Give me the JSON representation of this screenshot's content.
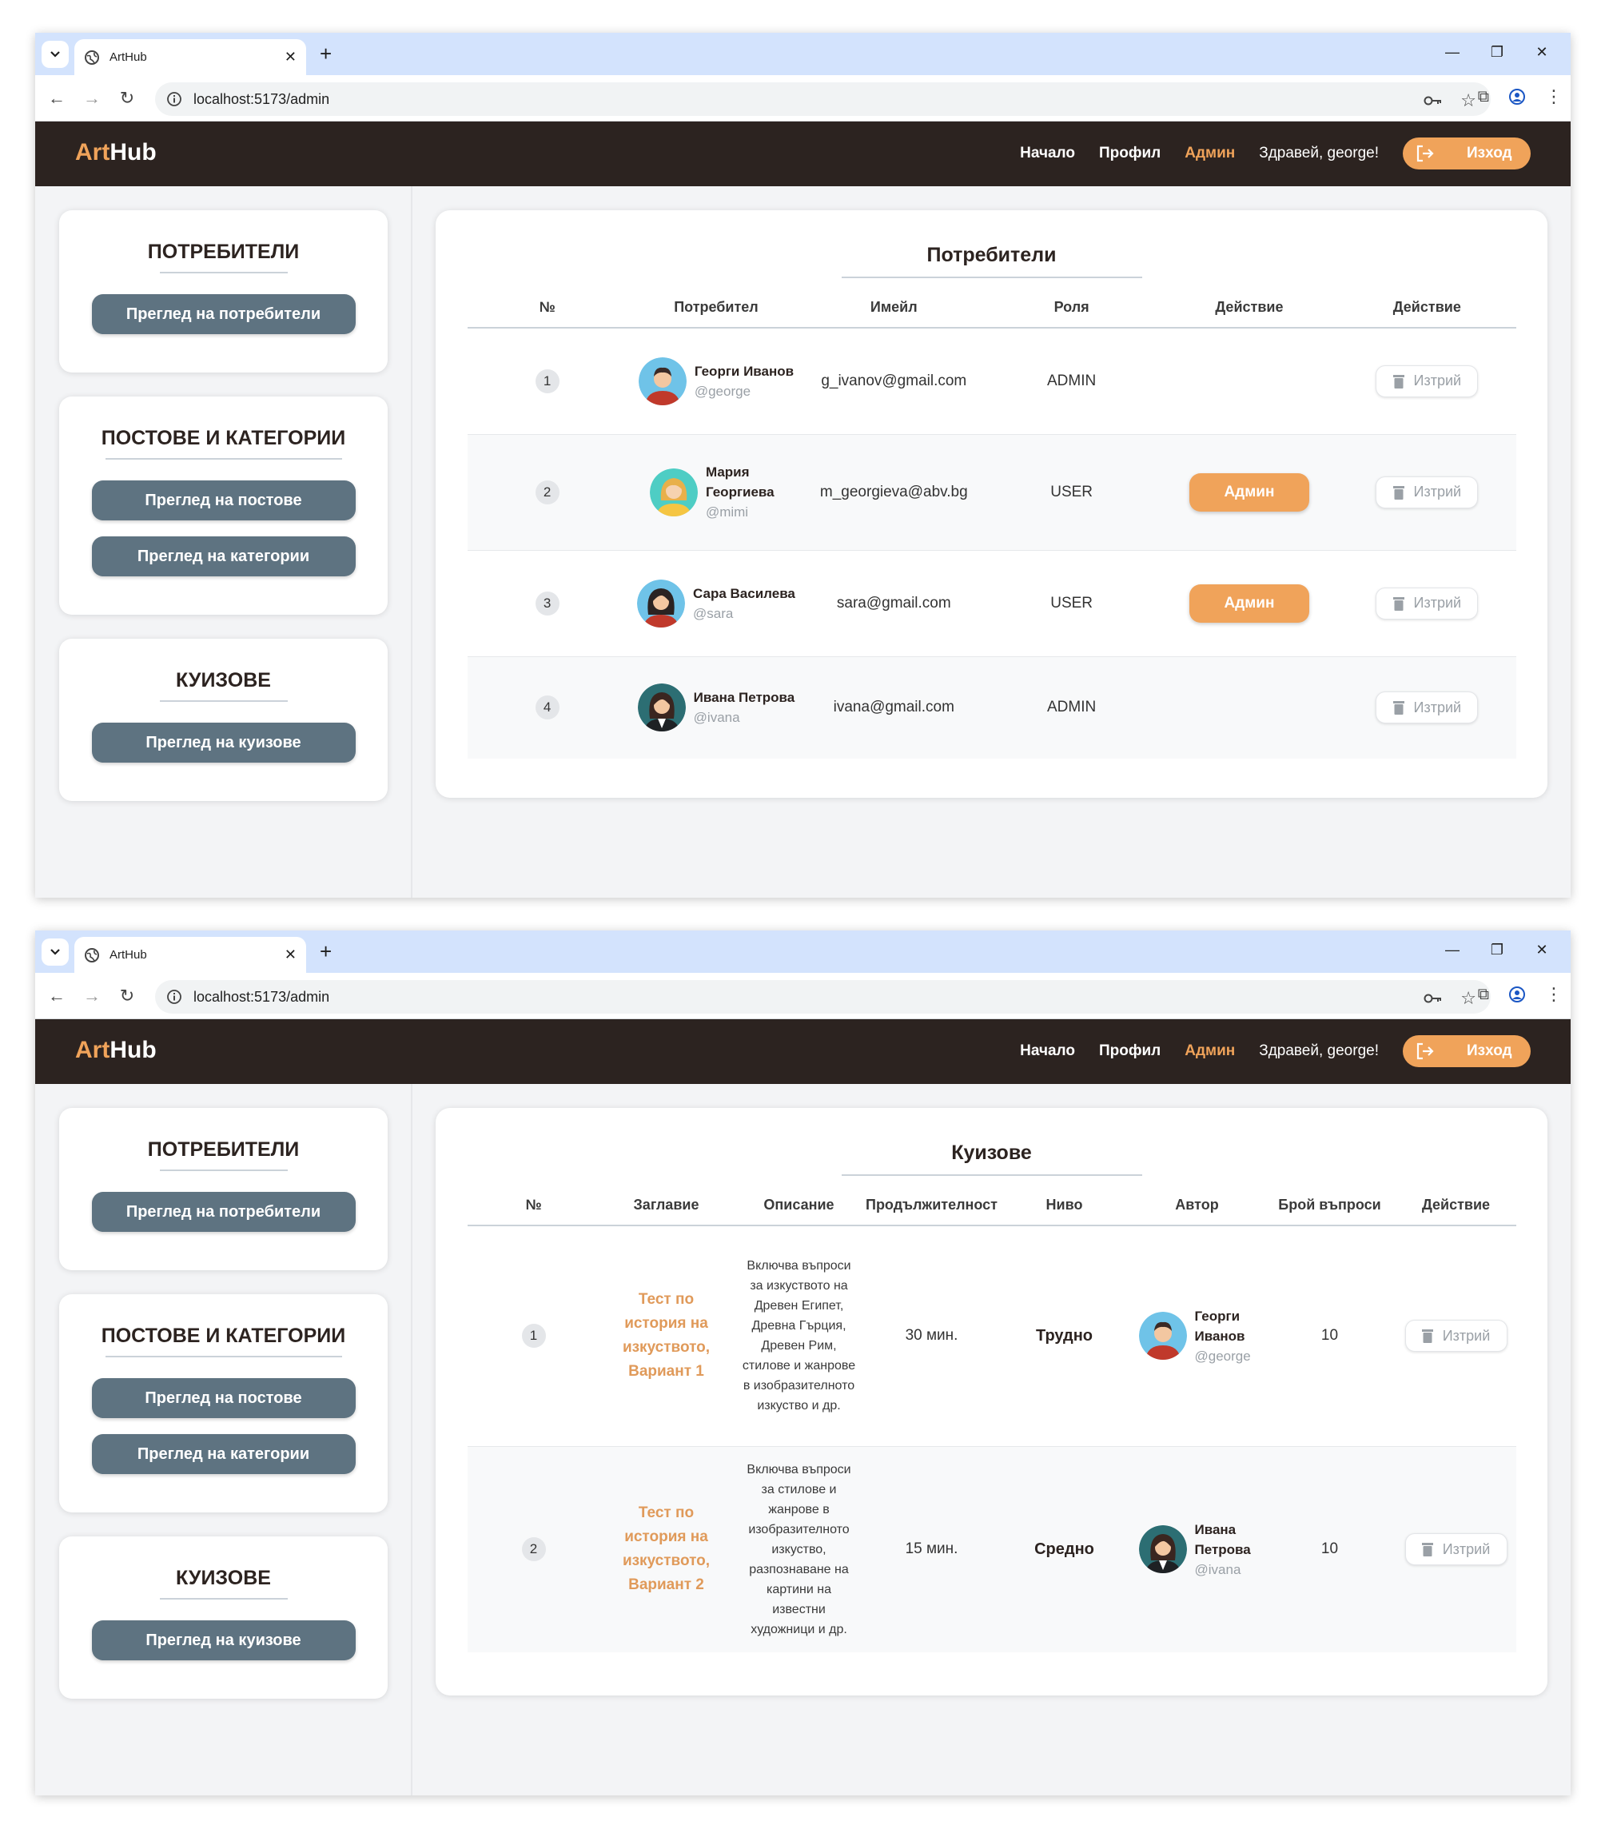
{
  "browser": {
    "tab_title": "ArtHub",
    "url": "localhost:5173/admin"
  },
  "header": {
    "logo_part1": "Art",
    "logo_part2": "Hub",
    "nav": [
      "Начало",
      "Профил",
      "Админ"
    ],
    "greeting": "Здравей, george!",
    "logout": "Изход",
    "accent_color": "#f0a35a",
    "bg_color": "#2c2320"
  },
  "sidebar": {
    "users_title": "ПОТРЕБИТЕЛИ",
    "users_btn": "Преглед на потребители",
    "posts_title": "ПОСТОВЕ И КАТЕГОРИИ",
    "posts_btn": "Преглед на постове",
    "categories_btn": "Преглед на категории",
    "quizzes_title": "КУИЗОВЕ",
    "quizzes_btn": "Преглед на куизове"
  },
  "users_view": {
    "title": "Потребители",
    "columns": [
      "№",
      "Потребител",
      "Имейл",
      "Роля",
      "Действие",
      "Действие"
    ],
    "rows": [
      {
        "n": "1",
        "name": "Георги Иванов",
        "handle": "@george",
        "email": "g_ivanov@gmail.com",
        "role": "ADMIN",
        "admin_btn": "",
        "delete": "Изтрий",
        "avatar": "man-avatar"
      },
      {
        "n": "2",
        "name": "Мария Георгиева",
        "handle": "@mimi",
        "email": "m_georgieva@abv.bg",
        "role": "USER",
        "admin_btn": "Админ",
        "delete": "Изтрий",
        "avatar": "woman-blonde-avatar"
      },
      {
        "n": "3",
        "name": "Сара Василева",
        "handle": "@sara",
        "email": "sara@gmail.com",
        "role": "USER",
        "admin_btn": "Админ",
        "delete": "Изтрий",
        "avatar": "woman-dark-avatar"
      },
      {
        "n": "4",
        "name": "Ивана Петрова",
        "handle": "@ivana",
        "email": "ivana@gmail.com",
        "role": "ADMIN",
        "admin_btn": "",
        "delete": "Изтрий",
        "avatar": "woman-suit-avatar"
      }
    ]
  },
  "quizzes_view": {
    "title": "Куизове",
    "columns": [
      "№",
      "Заглавие",
      "Описание",
      "Продължителност",
      "Ниво",
      "Автор",
      "Брой въпроси",
      "Действие"
    ],
    "rows": [
      {
        "n": "1",
        "title": "Тест по история на изкуството, Вариант 1",
        "description": "Включва въпроси за изкуството на Древен Египет, Древна Гърция, Древен Рим, стилове и жанрове в изобразителното изкуство и др.",
        "duration": "30 мин.",
        "level": "Трудно",
        "author_name": "Георги Иванов",
        "author_handle": "@george",
        "questions": "10",
        "delete": "Изтрий"
      },
      {
        "n": "2",
        "title": "Тест по история на изкуството, Вариант 2",
        "description": "Включва въпроси за стилове и жанрове в изобразителното изкуство, разпознаване на картини на известни художници и др.",
        "duration": "15 мин.",
        "level": "Средно",
        "author_name": "Ивана Петрова",
        "author_handle": "@ivana",
        "questions": "10",
        "delete": "Изтрий"
      }
    ]
  }
}
